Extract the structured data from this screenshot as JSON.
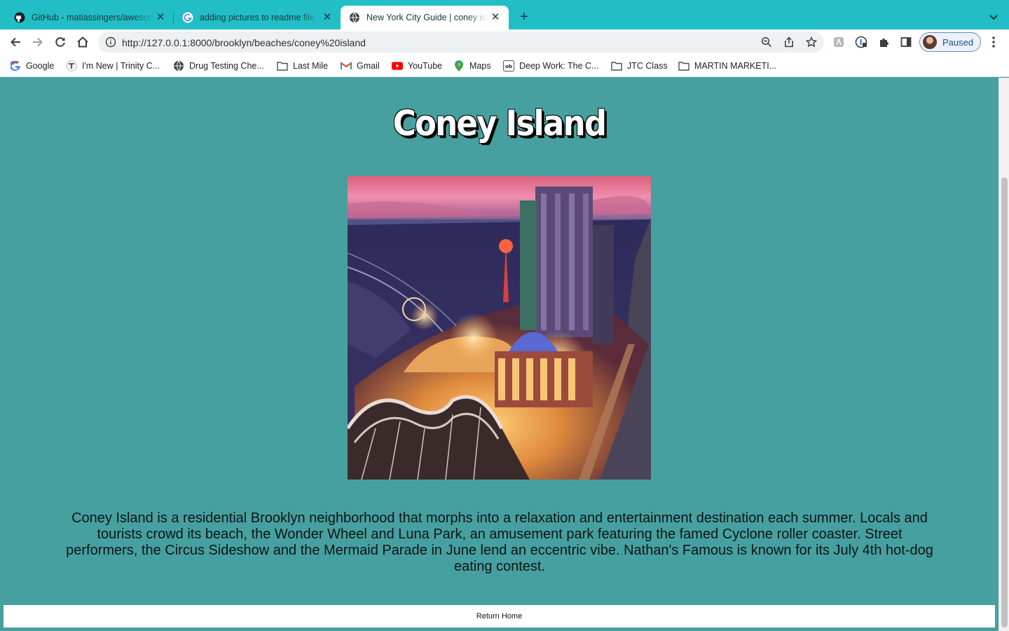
{
  "browser": {
    "tabs": [
      {
        "title": "GitHub - matiassingers/awesome-readme",
        "favicon": "github-icon",
        "active": false
      },
      {
        "title": "adding pictures to readme file",
        "favicon": "google-icon",
        "active": false
      },
      {
        "title": "New York City Guide | coney island",
        "favicon": "globe-icon",
        "active": true
      }
    ],
    "new_tab": "+",
    "close_glyph": "✕",
    "url": "http://127.0.0.1:8000/brooklyn/beaches/coney%20island",
    "profile_label": "Paused",
    "bookmarks": [
      {
        "label": "Google",
        "icon": "google-icon"
      },
      {
        "label": "I'm New | Trinity C...",
        "icon": "trinity-icon"
      },
      {
        "label": "Drug Testing Che...",
        "icon": "globe-icon"
      },
      {
        "label": "Last Mile",
        "icon": "folder-icon"
      },
      {
        "label": "Gmail",
        "icon": "gmail-icon"
      },
      {
        "label": "YouTube",
        "icon": "youtube-icon"
      },
      {
        "label": "Maps",
        "icon": "maps-icon"
      },
      {
        "label": "Deep Work: The C...",
        "icon": "ob-icon"
      },
      {
        "label": "JTC Class",
        "icon": "folder-icon"
      },
      {
        "label": "MARTIN MARKETI...",
        "icon": "folder-icon"
      }
    ],
    "colors": {
      "tab_strip": "#21bec6",
      "page_background": "#46a0a0"
    }
  },
  "page": {
    "title": "Coney Island",
    "image_subject": "Coney Island amusement park aerial illustration",
    "description": "Coney Island is a residential Brooklyn neighborhood that morphs into a relaxation and entertainment destination each summer. Locals and tourists crowd its beach, the Wonder Wheel and Luna Park, an amusement park featuring the famed Cyclone roller coaster. Street performers, the Circus Sideshow and the Mermaid Parade in June lend an eccentric vibe. Nathan's Famous is known for its July 4th hot-dog eating contest.",
    "return_label": "Return Home"
  }
}
